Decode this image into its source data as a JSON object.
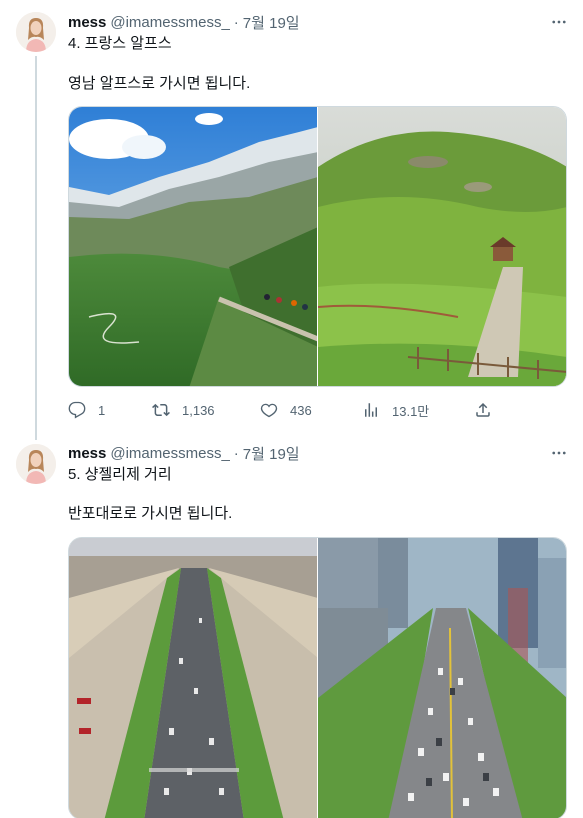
{
  "tweets": [
    {
      "name": "mess",
      "handle": "@imamessmess_",
      "dot": "·",
      "date": "7월 19일",
      "more": "···",
      "line1": "4. 프랑스 알프스",
      "line2": "영남 알프스로 가시면 됩니다.",
      "reply_count": "1",
      "retweet_count": "1,136",
      "like_count": "436",
      "view_count": "13.1만"
    },
    {
      "name": "mess",
      "handle": "@imamessmess_",
      "dot": "·",
      "date": "7월 19일",
      "more": "···",
      "line1": "5. 샹젤리제 거리",
      "line2": "반포대로로 가시면 됩니다."
    }
  ],
  "icons": {
    "reply": "reply-icon",
    "retweet": "retweet-icon",
    "like": "heart-icon",
    "views": "views-icon",
    "share": "share-icon",
    "more": "more-icon"
  },
  "colors": {
    "text": "#0f1419",
    "secondary": "#536471",
    "border": "#cfd9de"
  }
}
